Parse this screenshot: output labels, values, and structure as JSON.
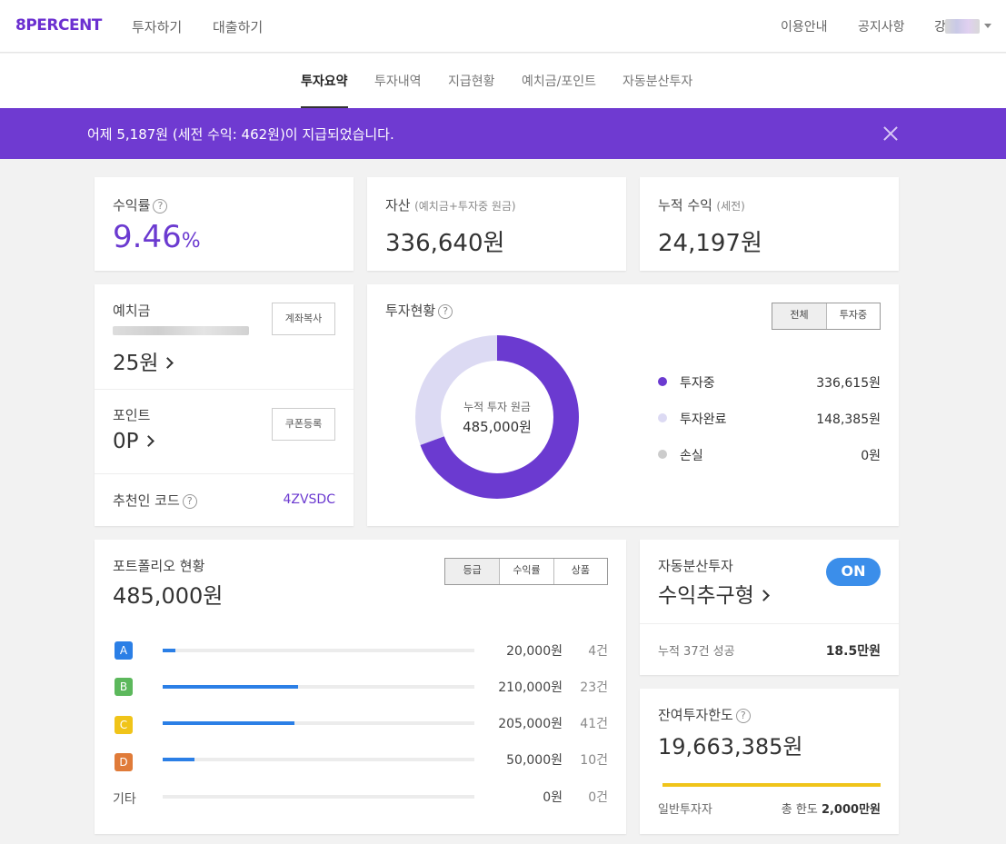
{
  "brand": {
    "logo": "8PERCENT",
    "accent": "#6f3ad1"
  },
  "topnav": {
    "menu": [
      "투자하기",
      "대출하기"
    ],
    "right": [
      "이용안내",
      "공지사항"
    ],
    "user_initial": "강"
  },
  "subnav": {
    "tabs": [
      "투자요약",
      "투자내역",
      "지급현황",
      "예치금/포인트",
      "자동분산투자"
    ],
    "active": "투자요약"
  },
  "banner": {
    "message": "어제 5,187원 (세전 수익: 462원)이 지급되었습니다."
  },
  "yield_card": {
    "label": "수익률",
    "help": "?",
    "value": "9.46",
    "unit": "%"
  },
  "asset_card": {
    "label": "자산",
    "sub": "(예치금+투자중 원금)",
    "value": "336,640원"
  },
  "profit_card": {
    "label": "누적 수익",
    "sub": "(세전)",
    "value": "24,197원"
  },
  "deposit_card": {
    "label": "예치금",
    "amount": "25원",
    "copy_button": "계좌복사",
    "points_label": "포인트",
    "points_value": "0P",
    "coupon_button": "쿠폰등록",
    "referral_label": "추천인 코드",
    "referral_code": "4ZVSDC"
  },
  "investment_status": {
    "title": "투자현황",
    "segments": [
      "전체",
      "투자중"
    ],
    "active_segment": "전체",
    "center_label": "누적 투자 원금",
    "center_value": "485,000원",
    "legend": [
      {
        "label": "투자중",
        "value": "336,615원",
        "color": "#6b3ad0"
      },
      {
        "label": "투자완료",
        "value": "148,385원",
        "color": "#dcdaf3"
      },
      {
        "label": "손실",
        "value": "0원",
        "color": "#cccccc"
      }
    ],
    "donut": {
      "investing": 336615,
      "completed": 148385,
      "loss": 0
    }
  },
  "portfolio": {
    "title": "포트폴리오 현황",
    "total": "485,000원",
    "segments": [
      "등급",
      "수익률",
      "상품"
    ],
    "active_segment": "등급",
    "rows": [
      {
        "grade": "A",
        "color": "#2b7fe6",
        "fraction": 0.041,
        "amount": "20,000원",
        "count": "4건"
      },
      {
        "grade": "B",
        "color": "#5cb85c",
        "fraction": 0.433,
        "amount": "210,000원",
        "count": "23건"
      },
      {
        "grade": "C",
        "color": "#f0c419",
        "fraction": 0.423,
        "amount": "205,000원",
        "count": "41건"
      },
      {
        "grade": "D",
        "color": "#e07b39",
        "fraction": 0.103,
        "amount": "50,000원",
        "count": "10건"
      },
      {
        "grade": "기타",
        "color": "",
        "fraction": 0,
        "amount": "0원",
        "count": "0건"
      }
    ]
  },
  "auto_invest": {
    "label": "자동분산투자",
    "type": "수익추구형",
    "toggle": "ON",
    "success_label": "누적 37건 성공",
    "success_value": "18.5만원"
  },
  "limit_card": {
    "label": "잔여투자한도",
    "value": "19,663,385원",
    "fraction_remaining": 1.0,
    "investor_type": "일반투자자",
    "total_limit_label": "총 한도",
    "total_limit_value": "2,000만원"
  }
}
